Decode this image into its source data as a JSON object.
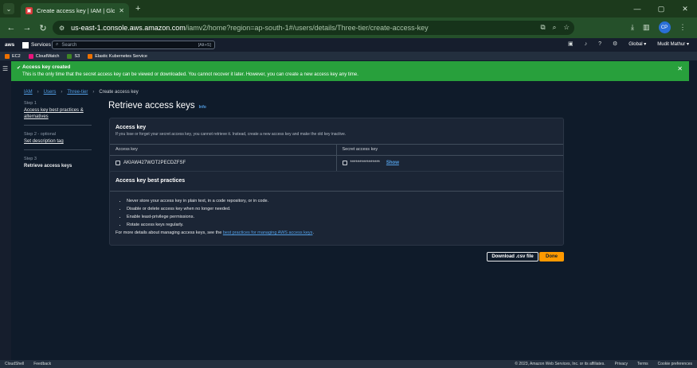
{
  "browser": {
    "tab_title": "Create access key | IAM | Global",
    "tab_favicon": "IAM",
    "url_host": "us-east-1.console.aws.amazon.com",
    "url_path": "/iamv2/home?region=ap-south-1#/users/details/Three-tier/create-access-key",
    "profile_initials": "CP"
  },
  "aws_nav": {
    "logo": "aws",
    "services_label": "Services",
    "search_placeholder": "Search",
    "search_shortcut": "[Alt+S]",
    "region": "Global ▾",
    "account": "Mudit Mathur ▾"
  },
  "favorites": [
    {
      "label": "EC2",
      "color": "#ed7100"
    },
    {
      "label": "CloudWatch",
      "color": "#e7157b"
    },
    {
      "label": "S3",
      "color": "#3f8624"
    },
    {
      "label": "Elastic Kubernetes Service",
      "color": "#ed7100"
    }
  ],
  "flash": {
    "title": "Access key created",
    "message": "This is the only time that the secret access key can be viewed or downloaded. You cannot recover it later. However, you can create a new access key any time."
  },
  "breadcrumb": {
    "items": [
      "IAM",
      "Users",
      "Three-tier"
    ],
    "current": "Create access key"
  },
  "steps": [
    {
      "label": "Step 1",
      "name": "Access key best practices & alternatives"
    },
    {
      "label": "Step 2 - optional",
      "name": "Set description tag"
    },
    {
      "label": "Step 3",
      "name": "Retrieve access keys"
    }
  ],
  "page": {
    "title": "Retrieve access keys",
    "info": "Info"
  },
  "access_key_card": {
    "title": "Access key",
    "description": "If you lose or forget your secret access key, you cannot retrieve it. Instead, create a new access key and make the old key inactive.",
    "col_access_key": "Access key",
    "col_secret_key": "Secret access key",
    "access_key_value": "AKIAW427WOT2PECDZFSF",
    "secret_key_masked": "****************",
    "show_label": "Show"
  },
  "best_practices_card": {
    "title": "Access key best practices",
    "items": [
      "Never store your access key in plain text, in a code repository, or in code.",
      "Disable or delete access key when no longer needed.",
      "Enable least-privilege permissions.",
      "Rotate access keys regularly."
    ],
    "more_prefix": "For more details about managing access keys, see the ",
    "more_link": "best practices for managing AWS access keys",
    "more_suffix": "."
  },
  "actions": {
    "download_label": "Download .csv file",
    "done_label": "Done"
  },
  "footer": {
    "cloudshell": "CloudShell",
    "feedback": "Feedback",
    "copyright": "© 2023, Amazon Web Services, Inc. or its affiliates.",
    "privacy": "Privacy",
    "terms": "Terms",
    "cookies": "Cookie preferences"
  },
  "colors": {
    "flash_green": "#28a03c",
    "accent_orange": "#ff9900",
    "link_blue": "#539fe5"
  }
}
